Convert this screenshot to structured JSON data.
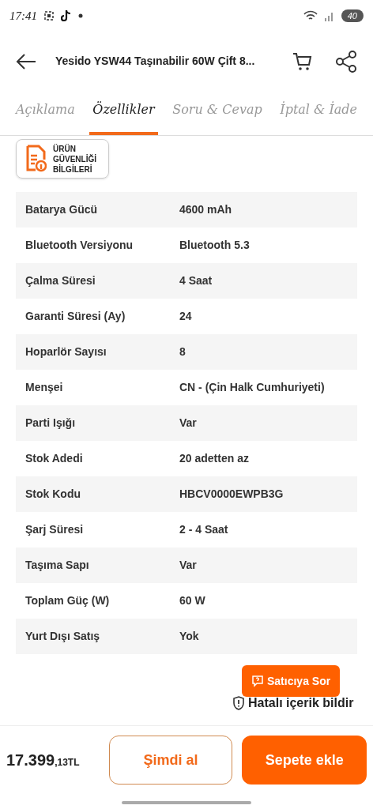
{
  "status_bar": {
    "time": "17:41",
    "battery": "40"
  },
  "header": {
    "title": "Yesido YSW44 Taşınabilir 60W Çift 8..."
  },
  "tabs": [
    {
      "label": "Açıklama",
      "selected": false
    },
    {
      "label": "Özellikler",
      "selected": true
    },
    {
      "label": "Soru & Cevap",
      "selected": false
    },
    {
      "label": "İptal & İade",
      "selected": false
    }
  ],
  "safety_badge": {
    "lines": [
      "ÜRÜN",
      "GÜVENLİĞİ",
      "BİLGİLERİ"
    ]
  },
  "specs": [
    {
      "name": "Batarya Gücü",
      "value": "4600 mAh"
    },
    {
      "name": "Bluetooth Versiyonu",
      "value": "Bluetooth 5.3"
    },
    {
      "name": "Çalma Süresi",
      "value": "4 Saat"
    },
    {
      "name": "Garanti Süresi (Ay)",
      "value": "24"
    },
    {
      "name": "Hoparlör Sayısı",
      "value": "8"
    },
    {
      "name": "Menşei",
      "value": "CN - (Çin Halk Cumhuriyeti)"
    },
    {
      "name": "Parti Işığı",
      "value": "Var"
    },
    {
      "name": "Stok Adedi",
      "value": "20 adetten az"
    },
    {
      "name": "Stok Kodu",
      "value": "HBCV0000EWPB3G"
    },
    {
      "name": "Şarj Süresi",
      "value": "2 - 4 Saat"
    },
    {
      "name": "Taşıma Sapı",
      "value": "Var"
    },
    {
      "name": "Toplam Güç (W)",
      "value": "60 W"
    },
    {
      "name": "Yurt Dışı Satış",
      "value": "Yok"
    }
  ],
  "ask_seller": "Satıcıya Sor",
  "report_link": "Hatalı içerik bildir",
  "price": {
    "main": "17.399",
    "fraction": ",13TL"
  },
  "buttons": {
    "buy_now": "Şimdi al",
    "add_to_cart": "Sepete ekle"
  }
}
